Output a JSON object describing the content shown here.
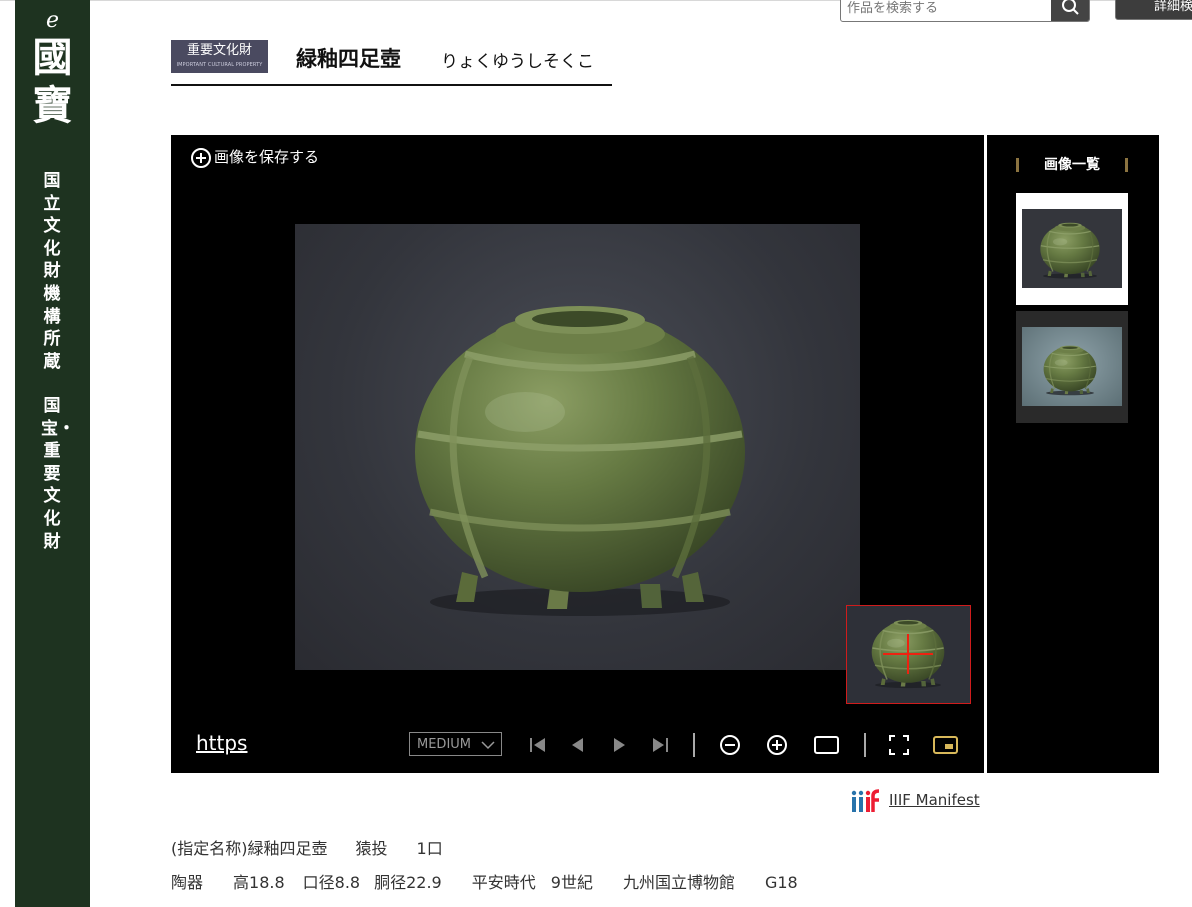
{
  "sidebar": {
    "logo_e": "e",
    "logo_k1": "國",
    "logo_k2": "寶",
    "vertical_1": "国立文化財機構所蔵",
    "vertical_2": "国宝・重要文化財"
  },
  "search": {
    "placeholder": "作品を検索する",
    "detail_label": "詳細検"
  },
  "title": {
    "badge": "重要文化財",
    "badge_sub": "IMPORTANT CULTURAL PROPERTY",
    "name": "緑釉四足壺",
    "reading": "りょくゆうしそくこ"
  },
  "viewer": {
    "save_label": "画像を保存する",
    "url_text": "https",
    "quality": "MEDIUM",
    "icons": [
      "first-page-icon",
      "prev-icon",
      "next-icon",
      "last-page-icon",
      "zoom-out-icon",
      "zoom-in-icon",
      "fit-window-icon",
      "fullscreen-icon",
      "navigator-toggle-icon"
    ]
  },
  "thumbnails": {
    "title": "画像一覧",
    "count": 2
  },
  "iiif": {
    "label": "IIIF Manifest"
  },
  "info": {
    "line1": [
      "(指定名称)緑釉四足壺",
      "猿投",
      "1口"
    ],
    "line2": [
      "陶器",
      "高18.8",
      "口径8.8",
      "胴径22.9",
      "平安時代",
      "9世紀",
      "九州国立博物館",
      "G18"
    ]
  },
  "colors": {
    "sidebar": "#1e3320",
    "badge": "#4a4a60",
    "navigator_frame": "#d01c1c",
    "active_control": "#d8b85a"
  }
}
